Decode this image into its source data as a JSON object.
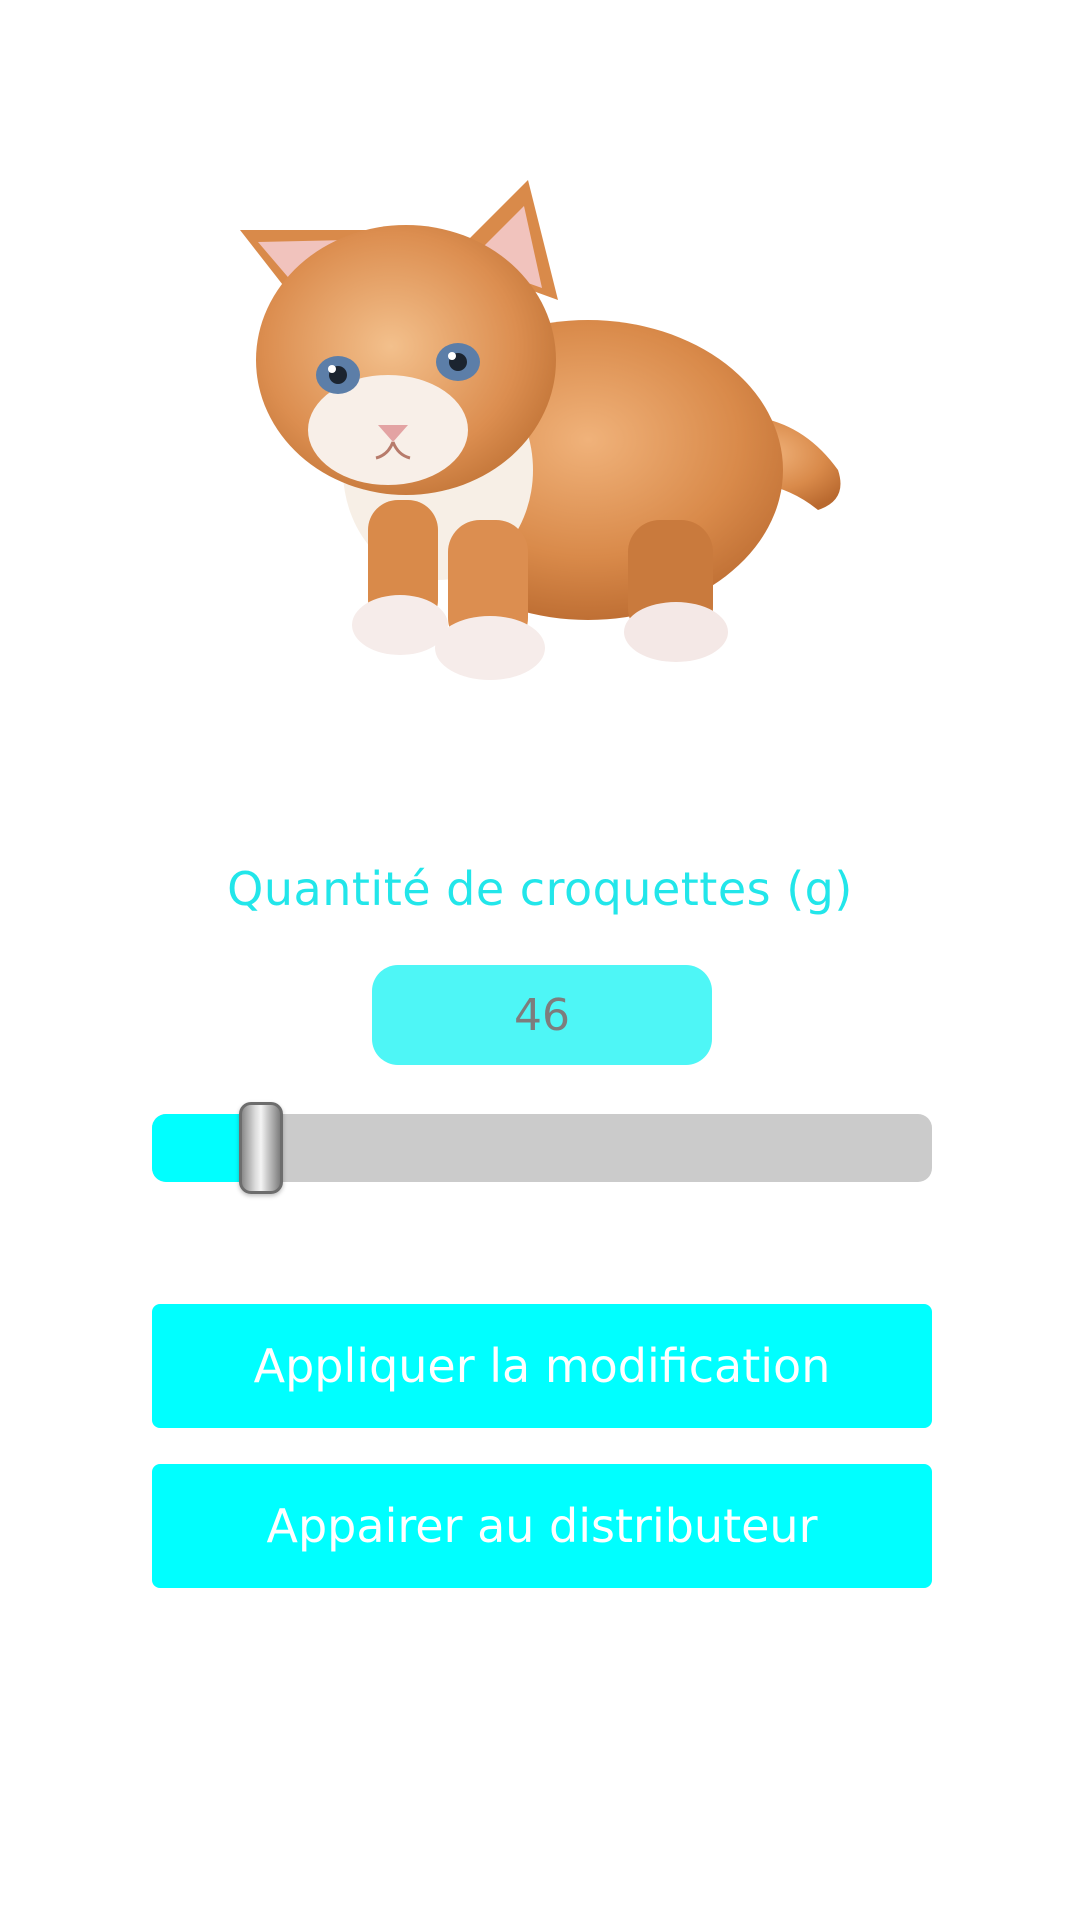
{
  "header_image": {
    "icon": "kitten-photo"
  },
  "quantity": {
    "label": "Quantité de croquettes (g)",
    "value": "46",
    "slider_fraction": 0.14
  },
  "buttons": {
    "apply_label": "Appliquer la modification",
    "pair_label": "Appairer au distributeur"
  },
  "colors": {
    "accent": "#00ffff",
    "label_text": "#22e6ea",
    "value_box": "#4ef6f6",
    "value_text": "#7d7d7d",
    "track": "#cbcbcb",
    "button_text": "#ffffff"
  }
}
